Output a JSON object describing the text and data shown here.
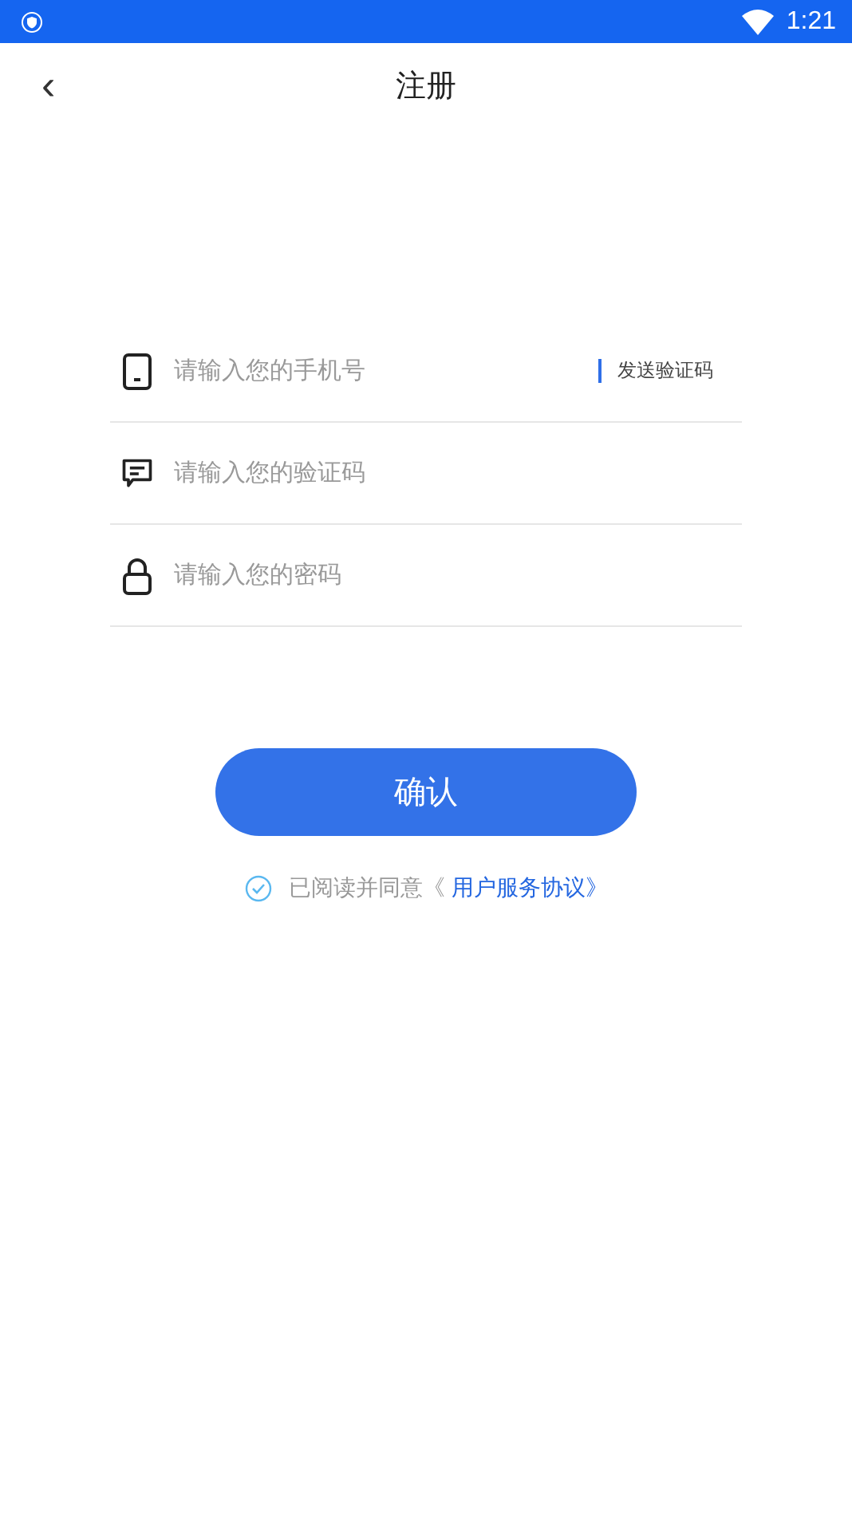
{
  "status_bar": {
    "time": "1:21"
  },
  "header": {
    "back": "‹",
    "title": "注册"
  },
  "fields": [
    {
      "kind": "phone",
      "placeholder": "请输入您的手机号",
      "action": "发送验证码"
    },
    {
      "kind": "message",
      "placeholder": "请输入您的验证码"
    },
    {
      "kind": "lock",
      "placeholder": "请输入您的密码"
    }
  ],
  "confirm_button": "确认",
  "agreement": {
    "checked": true,
    "text": "已阅读并同意《",
    "link": "用户服务协议》"
  }
}
